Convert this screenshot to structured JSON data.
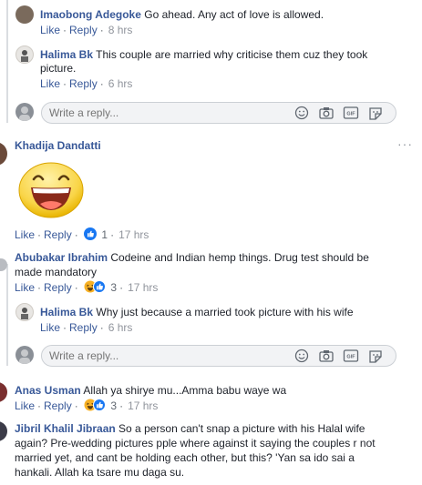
{
  "actions": {
    "like": "Like",
    "reply": "Reply"
  },
  "reply_placeholder": "Write a reply...",
  "comments": [
    {
      "name": "Imaobong Adegoke",
      "lines": [
        "Go ahead. Any act of love is allowed."
      ],
      "time": "8 hrs"
    },
    {
      "name": "Halima Bk",
      "lines": [
        "This couple are married why criticise them cuz they took",
        "picture."
      ],
      "time": "6 hrs"
    },
    {
      "name": "Khadija Dandatti",
      "time": "17 hrs",
      "reaction_count": "1"
    },
    {
      "name": "Abubakar Ibrahim",
      "lines": [
        "Codeine and Indian hemp things. Drug test should be",
        "made mandatory"
      ],
      "time": "17 hrs",
      "reaction_count": "3"
    },
    {
      "name": "Halima Bk",
      "lines": [
        "Why just because a married took picture with his wife"
      ],
      "time": "6 hrs"
    },
    {
      "name": "Anas Usman",
      "lines": [
        "Allah ya shirye mu...Amma babu waye wa"
      ],
      "time": "17 hrs",
      "reaction_count": "3"
    },
    {
      "name": "Jibril Khalil Jibraan",
      "lines": [
        "So a person can't snap a picture with his Halal wife",
        "again? Pre-wedding pictures pple where against it saying the couples r not",
        "married yet, and cant be holding each other, but this? 'Yan sa ido sai a",
        "hankali. Allah ka tsare mu daga su."
      ]
    }
  ],
  "colors": {
    "name": "#385898",
    "like": "#1877f2",
    "haha": "#f7b125"
  },
  "icons": [
    "emoji-icon",
    "camera-icon",
    "gif-icon",
    "sticker-icon",
    "more-options-icon",
    "big-laughing-emoji"
  ]
}
